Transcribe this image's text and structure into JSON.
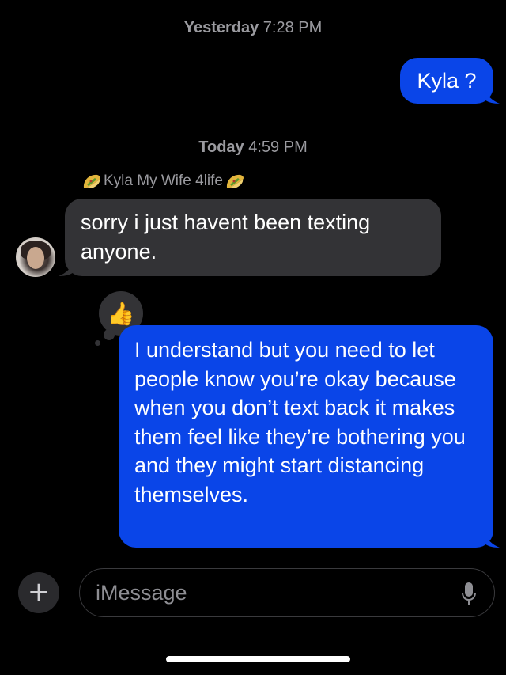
{
  "conversation": {
    "timestamps": [
      {
        "day": "Yesterday",
        "time": "7:28 PM"
      },
      {
        "day": "Today",
        "time": "4:59 PM"
      }
    ],
    "sender_name": "Kyla My Wife 4life",
    "messages": [
      {
        "direction": "outgoing",
        "text": "Kyla ?"
      },
      {
        "direction": "incoming",
        "text": "sorry i just havent been texting anyone."
      },
      {
        "direction": "outgoing",
        "text": "I understand but you need to let people know you’re okay because when you don’t text back it makes them feel like they’re bothering you and they might start distancing themselves."
      }
    ],
    "tapback": {
      "emoji": "👍",
      "icon": "thumbs-up-icon"
    }
  },
  "composer": {
    "plus_label": "+",
    "placeholder": "iMessage"
  },
  "colors": {
    "outgoing_bubble": "#0a45e8",
    "incoming_bubble": "#333336",
    "background": "#000000",
    "timestamp_text": "#9a9a9f"
  }
}
